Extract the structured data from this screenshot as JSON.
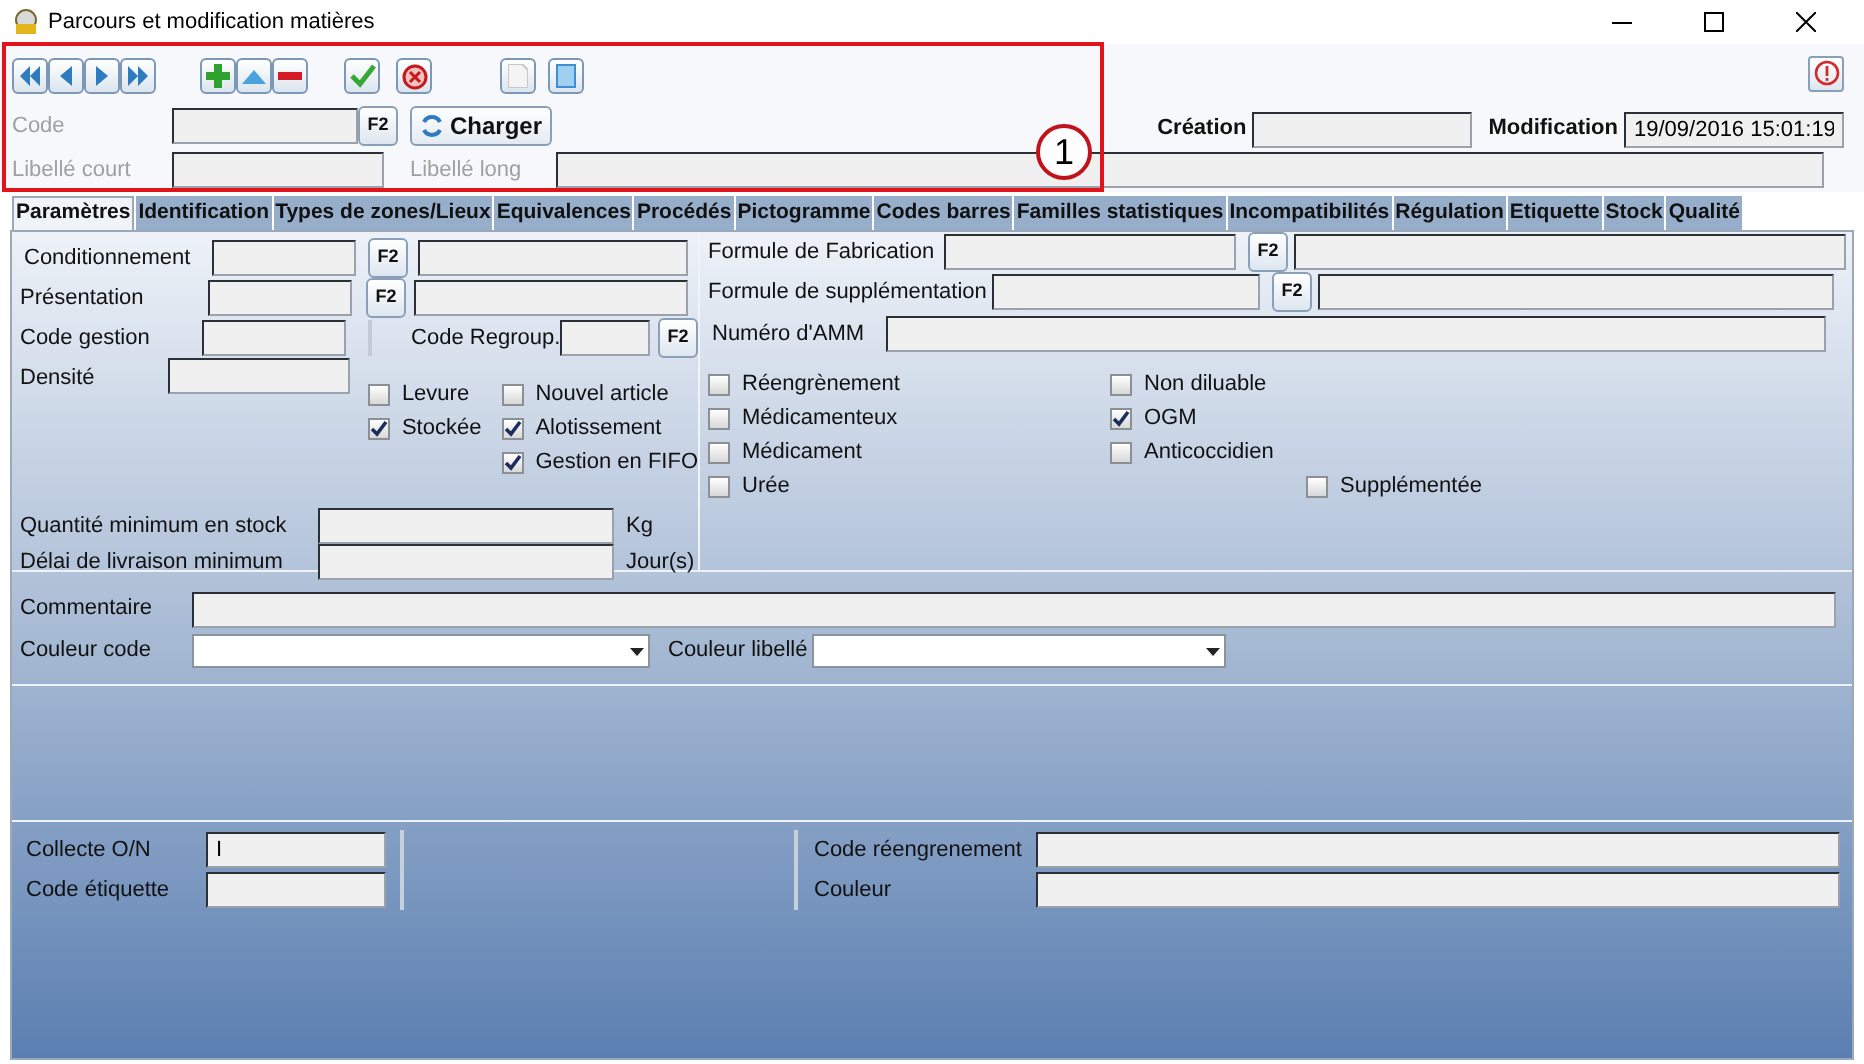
{
  "window": {
    "title": "Parcours et modification matières"
  },
  "header": {
    "code": {
      "label": "Code",
      "disabled": true,
      "f2": "F2"
    },
    "load_button": "Charger",
    "short_label": {
      "label": "Libellé court",
      "disabled": true
    },
    "long_label": {
      "label": "Libellé long",
      "disabled": true
    },
    "creation": {
      "label": "Création"
    },
    "modification": {
      "label": "Modification",
      "value": "19/09/2016 15:01:19"
    }
  },
  "annotation": {
    "number": "1"
  },
  "tabs": [
    {
      "label": "Paramètres",
      "selected": true
    },
    {
      "label": "Identification",
      "selected": false
    },
    {
      "label": "Types de zones/Lieux",
      "selected": false
    },
    {
      "label": "Equivalences",
      "selected": false
    },
    {
      "label": "Procédés",
      "selected": false
    },
    {
      "label": "Pictogramme",
      "selected": false
    },
    {
      "label": "Codes barres",
      "selected": false
    },
    {
      "label": "Familles statistiques",
      "selected": false
    },
    {
      "label": "Incompatibilités",
      "selected": false
    },
    {
      "label": "Régulation",
      "selected": false
    },
    {
      "label": "Etiquette",
      "selected": false
    },
    {
      "label": "Stock",
      "selected": false
    },
    {
      "label": "Qualité",
      "selected": false
    }
  ],
  "parameters": {
    "conditionnement": {
      "label": "Conditionnement",
      "f2": "F2"
    },
    "presentation": {
      "label": "Présentation",
      "f2": "F2"
    },
    "code_gestion": {
      "label": "Code gestion"
    },
    "code_regroup": {
      "label": "Code Regroup.",
      "f2": "F2"
    },
    "densite": {
      "label": "Densité"
    },
    "checkbox_columns": [
      [
        {
          "label": "Levure",
          "checked": false
        },
        {
          "label": "Stockée",
          "checked": true
        }
      ],
      [
        {
          "label": "Nouvel article",
          "checked": false
        },
        {
          "label": "Alotissement",
          "checked": true
        },
        {
          "label": "Gestion en FIFO",
          "checked": true
        }
      ]
    ],
    "stock_min": {
      "label": "Quantité minimum en stock",
      "unit": "Kg"
    },
    "delivery_min": {
      "label": "Délai de livraison minimum",
      "unit": "Jour(s)"
    }
  },
  "formulas": {
    "fabrication": {
      "label": "Formule de Fabrication",
      "f2": "F2"
    },
    "supplementation": {
      "label": "Formule de supplémentation",
      "f2": "F2"
    },
    "amm": {
      "label": "Numéro d'AMM"
    },
    "checkbox_columns": [
      [
        {
          "label": "Réengrènement",
          "checked": false
        },
        {
          "label": "Médicamenteux",
          "checked": false
        },
        {
          "label": "Médicament",
          "checked": false
        },
        {
          "label": "Urée",
          "checked": false
        }
      ],
      [
        {
          "label": "Non diluable",
          "checked": false
        },
        {
          "label": "OGM",
          "checked": true
        },
        {
          "label": "Anticoccidien",
          "checked": false
        }
      ],
      [
        {
          "label": "Supplémentée",
          "checked": false
        }
      ]
    ]
  },
  "comment": {
    "label": "Commentaire"
  },
  "color_code": {
    "label": "Couleur code"
  },
  "color_label": {
    "label": "Couleur libellé"
  },
  "bottom": {
    "collect": {
      "label": "Collecte O/N",
      "value": "I"
    },
    "label_code": {
      "label": "Code étiquette"
    },
    "regrind_code": {
      "label": "Code réengrenement"
    },
    "color": {
      "label": "Couleur"
    }
  }
}
